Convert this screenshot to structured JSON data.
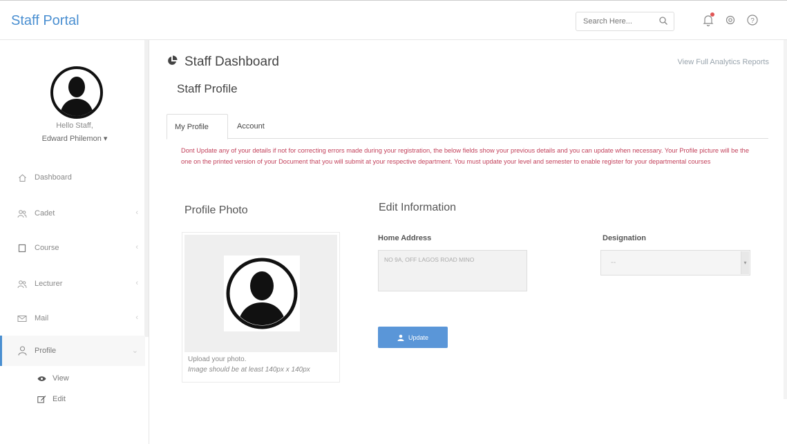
{
  "app": {
    "title": "Staff Portal"
  },
  "topbar": {
    "search_placeholder": "Search Here...",
    "icons": [
      "search-icon",
      "bell-icon",
      "gear-icon",
      "help-icon"
    ],
    "notification_color": "#e05555"
  },
  "sidebar": {
    "greeting": "Hello Staff,",
    "user_name": "Edward Philemon ▾",
    "items": [
      {
        "label": "Dashboard",
        "icon": "home-icon"
      },
      {
        "label": "Cadet",
        "icon": "users-icon"
      },
      {
        "label": "Course",
        "icon": "book-icon"
      },
      {
        "label": "Lecturer",
        "icon": "users-icon"
      },
      {
        "label": "Mail",
        "icon": "mail-icon"
      },
      {
        "label": "Profile",
        "icon": "user-icon"
      }
    ],
    "profile_sub": [
      {
        "label": "View",
        "icon": "eye-icon"
      },
      {
        "label": "Edit",
        "icon": "edit-icon"
      }
    ]
  },
  "main": {
    "title": "Staff Dashboard",
    "subtitle": "Staff Profile",
    "analytics_link": "View Full Analytics Reports",
    "tabs": [
      {
        "label": "My Profile",
        "active": true
      },
      {
        "label": "Account",
        "active": false
      }
    ],
    "warning": "Dont Update any of your details if not for correcting errors made during your registration, the below fields show your previous details and you can update when necessary. Your Profile picture will be the one on the printed version of your Document that you will submit at your respective department. You must update your level and semester to enable register for your departmental courses",
    "profile_photo": {
      "heading": "Profile Photo",
      "caption": "Upload your photo.",
      "hint": "Image should be at least 140px x 140px"
    },
    "edit_info": {
      "heading": "Edit Information",
      "home_address_label": "Home Address",
      "home_address_value": "NO 9A, OFF LAGOS ROAD MINO",
      "designation_label": "Designation",
      "designation_value": "--",
      "update_label": "Update"
    }
  },
  "colors": {
    "accent": "#4a8fd1",
    "warning": "#c2405a",
    "button": "#5a96d8"
  }
}
